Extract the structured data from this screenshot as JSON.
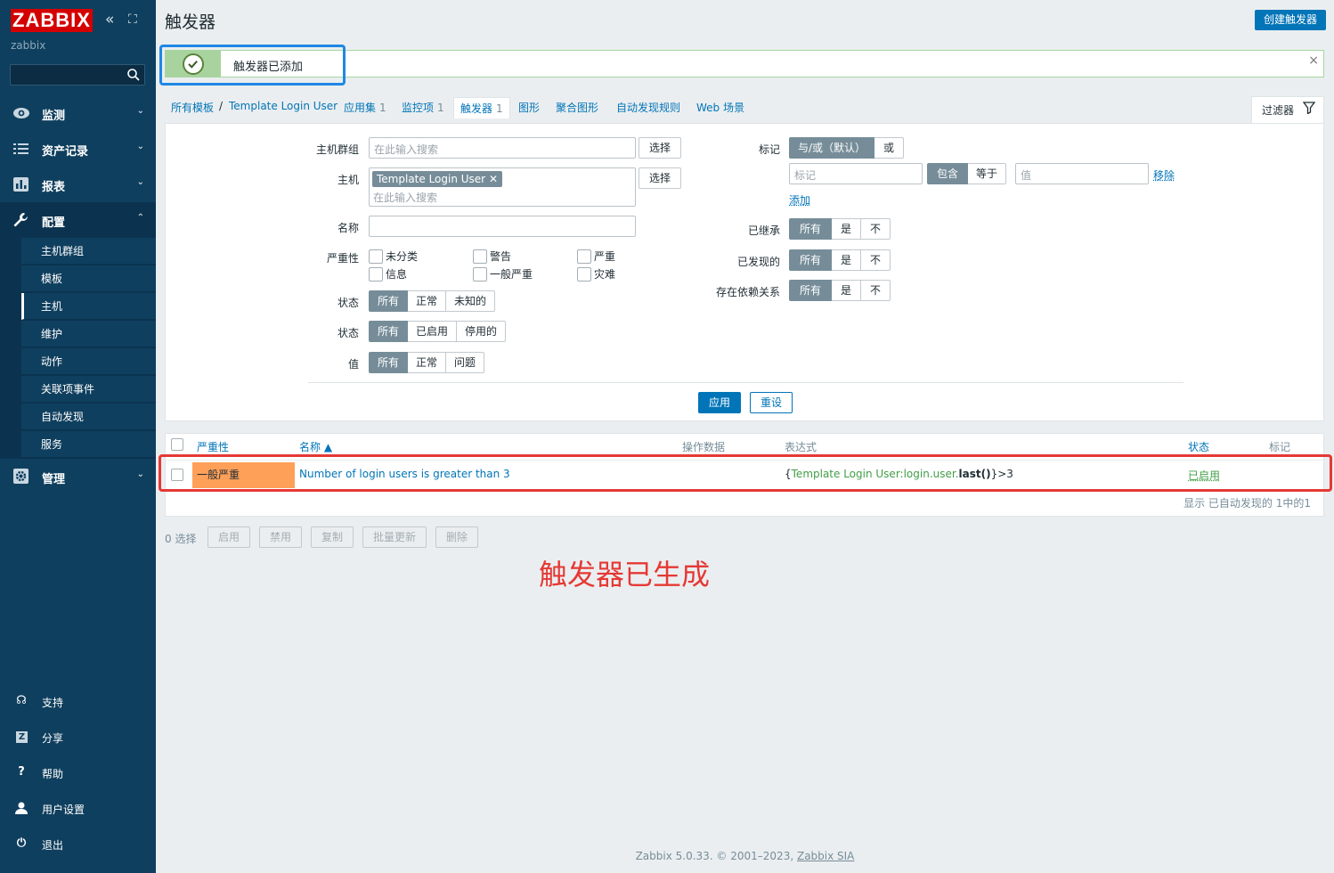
{
  "brand": {
    "logo": "ZABBIX",
    "user": "zabbix",
    "logo_color": "#d40000"
  },
  "sidebar": {
    "search_placeholder": "",
    "menu": [
      {
        "label": "监测",
        "icon": "eye-icon"
      },
      {
        "label": "资产记录",
        "icon": "list-icon"
      },
      {
        "label": "报表",
        "icon": "bar-chart-icon"
      },
      {
        "label": "配置",
        "icon": "wrench-icon"
      },
      {
        "label": "管理",
        "icon": "gear-icon"
      }
    ],
    "submenu": [
      "主机群组",
      "模板",
      "主机",
      "维护",
      "动作",
      "关联项事件",
      "自动发现",
      "服务"
    ],
    "selected_submenu": "主机",
    "bottom": [
      {
        "label": "支持",
        "icon": "headset-icon"
      },
      {
        "label": "分享",
        "icon": "share-icon"
      },
      {
        "label": "帮助",
        "icon": "help-icon"
      },
      {
        "label": "用户设置",
        "icon": "user-icon"
      },
      {
        "label": "退出",
        "icon": "power-icon"
      }
    ]
  },
  "header": {
    "title": "触发器",
    "create_button": "创建触发器"
  },
  "message": {
    "text": "触发器已添加",
    "close": "×"
  },
  "breadcrumb": {
    "all_templates": "所有模板",
    "sep": "/",
    "template": "Template Login User",
    "items": [
      {
        "label": "应用集",
        "count": "1"
      },
      {
        "label": "监控项",
        "count": "1"
      },
      {
        "label": "触发器",
        "count": "1"
      },
      {
        "label": "图形",
        "count": ""
      },
      {
        "label": "聚合图形",
        "count": ""
      },
      {
        "label": "自动发现规则",
        "count": ""
      },
      {
        "label": "Web 场景",
        "count": ""
      }
    ],
    "filter_tab": "过滤器"
  },
  "filter": {
    "host_group_label": "主机群组",
    "host_group_placeholder": "在此输入搜索",
    "select_button": "选择",
    "host_label": "主机",
    "host_chip": "Template Login User",
    "host_placeholder": "在此输入搜索",
    "name_label": "名称",
    "name_value": "",
    "severity_label": "严重性",
    "severities": [
      "未分类",
      "警告",
      "严重",
      "信息",
      "一般严重",
      "灾难"
    ],
    "state_label": "状态",
    "state_options": [
      "所有",
      "正常",
      "未知的"
    ],
    "status_label": "状态",
    "status_options": [
      "所有",
      "已启用",
      "停用的"
    ],
    "value_label": "值",
    "value_options": [
      "所有",
      "正常",
      "问题"
    ],
    "tags_label": "标记",
    "tags_mode": [
      "与/或（默认）",
      "或"
    ],
    "tag_placeholder": "标记",
    "tag_operators": [
      "包含",
      "等于"
    ],
    "tag_value_placeholder": "值",
    "tag_remove": "移除",
    "tag_add": "添加",
    "inherited_label": "已继承",
    "discovered_label": "已发现的",
    "dependencies_label": "存在依赖关系",
    "tri_options": [
      "所有",
      "是",
      "不"
    ],
    "apply": "应用",
    "reset": "重设"
  },
  "table": {
    "headers": {
      "severity": "严重性",
      "name": "名称 ▲",
      "operational": "操作数据",
      "expression": "表达式",
      "status": "状态",
      "tags": "标记"
    },
    "rows": [
      {
        "severity": "一般严重",
        "severity_color": "#ffa059",
        "name": "Number of login users is greater than 3",
        "expr_open": "{",
        "expr_host_key": "Template Login User:login.user.",
        "expr_func": "last()",
        "expr_close": "}>3",
        "status": "已启用"
      }
    ],
    "summary": "显示 已自动发现的 1中的1"
  },
  "actions": {
    "selected": "0 选择",
    "buttons": [
      "启用",
      "禁用",
      "复制",
      "批量更新",
      "删除"
    ]
  },
  "annotation": "触发器已生成",
  "footer": {
    "text": "Zabbix 5.0.33. © 2001–2023, ",
    "company": "Zabbix SIA"
  }
}
